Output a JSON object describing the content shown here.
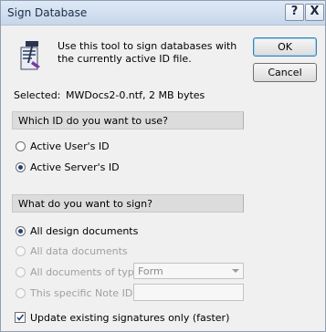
{
  "window": {
    "title": "Sign Database",
    "help_label": "?",
    "close_label": "X"
  },
  "description": "Use this tool to sign databases with the currently active ID file.",
  "buttons": {
    "ok": "OK",
    "cancel": "Cancel"
  },
  "selected": {
    "label": "Selected:",
    "value": "MWDocs2-0.ntf, 2 MB bytes"
  },
  "id_group": {
    "title": "Which ID do you want to use?",
    "options": [
      {
        "label": "Active User's ID",
        "checked": false
      },
      {
        "label": "Active Server's ID",
        "checked": true
      }
    ]
  },
  "sign_group": {
    "title": "What do you want to sign?",
    "options": [
      {
        "label": "All design documents",
        "checked": true,
        "enabled": true
      },
      {
        "label": "All data documents",
        "checked": false,
        "enabled": false
      },
      {
        "label": "All documents of type",
        "checked": false,
        "enabled": false
      },
      {
        "label": "This specific Note ID",
        "checked": false,
        "enabled": false
      }
    ],
    "doc_type_value": "Form",
    "note_id_value": ""
  },
  "update_existing": {
    "label": "Update existing signatures only (faster)",
    "checked": true
  }
}
